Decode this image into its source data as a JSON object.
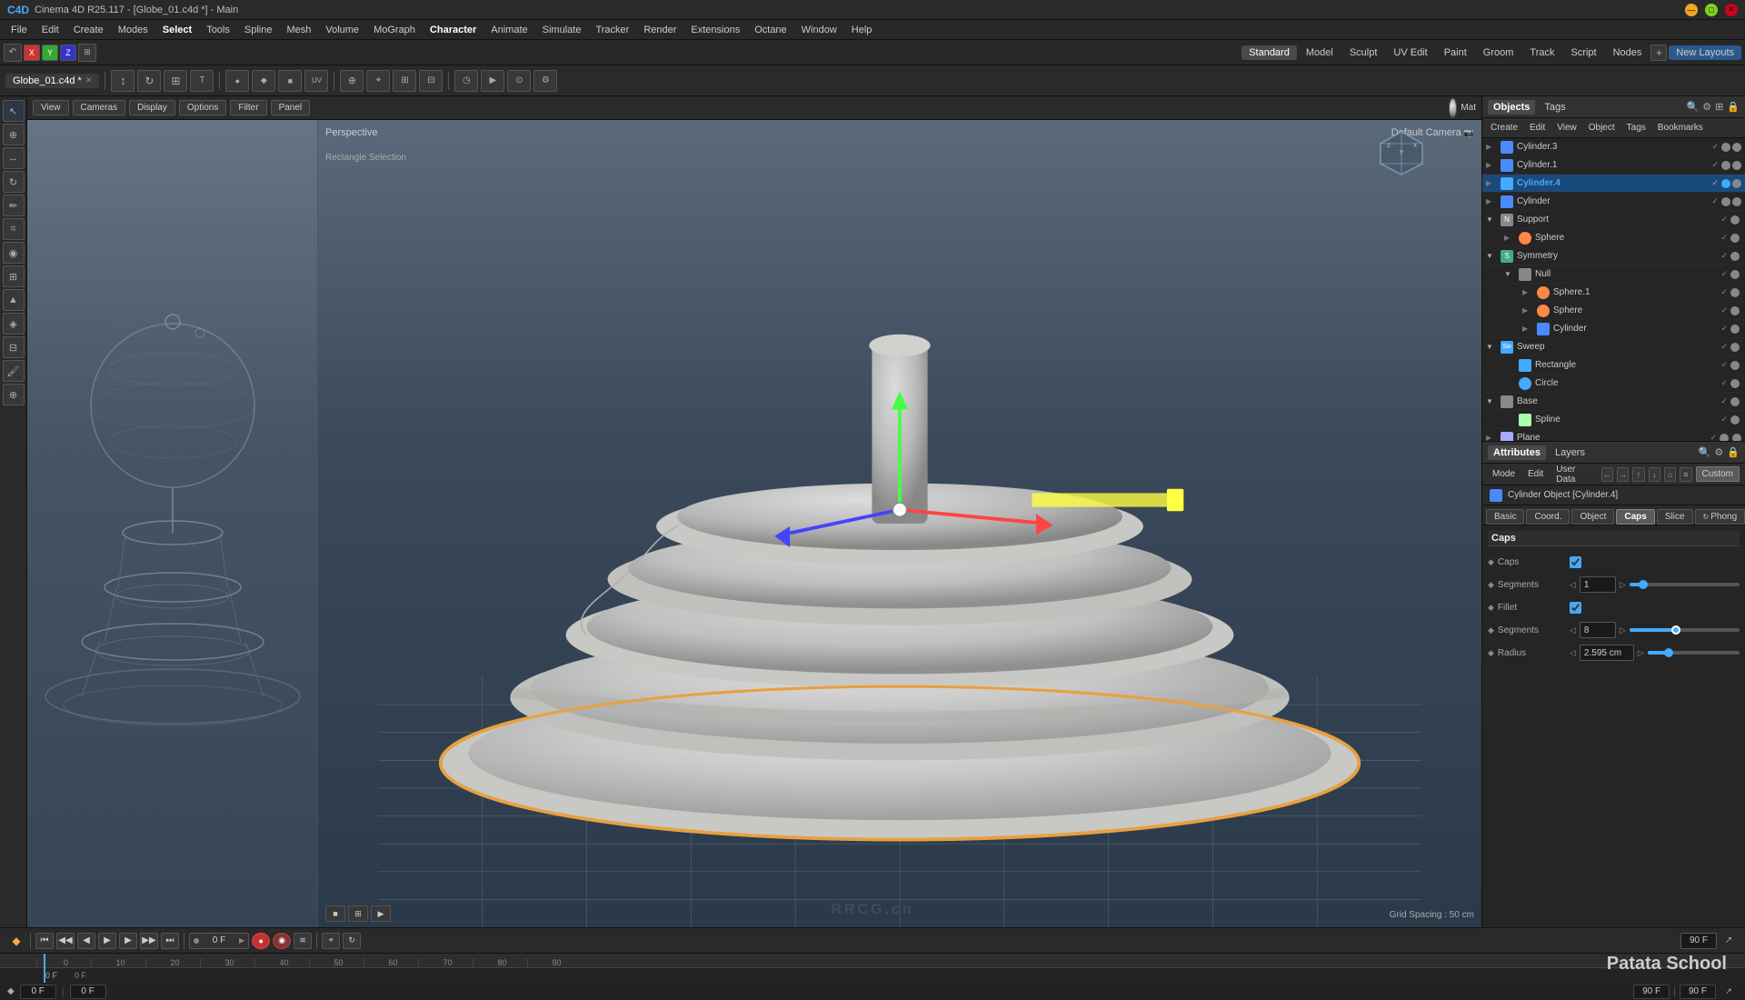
{
  "app": {
    "title": "Cinema 4D R25.117 - [Globe_01.c4d *] - Main",
    "version": "R25.117",
    "filename": "Globe_01.c4d",
    "watermark": "RRCG.cn"
  },
  "titlebar": {
    "title": "Cinema 4D R25.117 - [Globe_01.c4d *] - Main",
    "close": "✕",
    "minimize": "—",
    "maximize": "□"
  },
  "menubar": {
    "items": [
      "File",
      "Edit",
      "Create",
      "Modes",
      "Select",
      "Tools",
      "Spline",
      "Mesh",
      "Volume",
      "MoGraph",
      "Character",
      "Animate",
      "Simulate",
      "Tracker",
      "Render",
      "Extensions",
      "Octane",
      "Window",
      "Help"
    ]
  },
  "tabbar": {
    "tabs": [
      {
        "label": "Globe_01.c4d *",
        "active": true
      }
    ]
  },
  "toolbar": {
    "layout_label": "Standard",
    "mode_label": "Model",
    "sculpt_label": "Sculpt",
    "uv_label": "UV Edit",
    "paint_label": "Paint",
    "groom_label": "Groom",
    "track_label": "Track",
    "script_label": "Script",
    "nodes_label": "Nodes",
    "new_layouts_label": "New Layouts"
  },
  "viewport": {
    "perspective_label": "Perspective",
    "camera_label": "Default Camera",
    "grid_spacing": "Grid Spacing : 50 cm",
    "selection_label": "Rectangle Selection"
  },
  "objects_panel": {
    "title": "Objects",
    "tabs": [
      "Objects",
      "Tags"
    ],
    "secondary_tabs": [
      "Create",
      "Edit",
      "View",
      "Object",
      "Tags",
      "Bookmarks"
    ],
    "items": [
      {
        "name": "Cylinder.3",
        "indent": 0,
        "type": "cylinder",
        "color": "#888",
        "selected": false
      },
      {
        "name": "Cylinder.1",
        "indent": 0,
        "type": "cylinder",
        "color": "#888",
        "selected": false
      },
      {
        "name": "Cylinder.4",
        "indent": 0,
        "type": "cylinder",
        "color": "#4af",
        "selected": true,
        "highlight": true
      },
      {
        "name": "Cylinder",
        "indent": 0,
        "type": "cylinder",
        "color": "#888",
        "selected": false
      },
      {
        "name": "Support",
        "indent": 0,
        "type": "null",
        "color": "#888",
        "selected": false
      },
      {
        "name": "Sphere",
        "indent": 1,
        "type": "sphere",
        "color": "#888",
        "selected": false
      },
      {
        "name": "Symmetry",
        "indent": 0,
        "type": "symmetry",
        "color": "#888",
        "selected": false
      },
      {
        "name": "Null",
        "indent": 1,
        "type": "null",
        "color": "#888",
        "selected": false
      },
      {
        "name": "Sphere.1",
        "indent": 2,
        "type": "sphere",
        "color": "#888",
        "selected": false
      },
      {
        "name": "Sphere",
        "indent": 2,
        "type": "sphere",
        "color": "#888",
        "selected": false
      },
      {
        "name": "Cylinder",
        "indent": 2,
        "type": "cylinder",
        "color": "#888",
        "selected": false
      },
      {
        "name": "Sweep",
        "indent": 0,
        "type": "sweep",
        "color": "#888",
        "selected": false
      },
      {
        "name": "Rectangle",
        "indent": 1,
        "type": "rect",
        "color": "#888",
        "selected": false
      },
      {
        "name": "Circle",
        "indent": 1,
        "type": "circle",
        "color": "#888",
        "selected": false
      },
      {
        "name": "Base",
        "indent": 0,
        "type": "null",
        "color": "#888",
        "selected": false
      },
      {
        "name": "Spline",
        "indent": 1,
        "type": "spline",
        "color": "#888",
        "selected": false
      },
      {
        "name": "Plane",
        "indent": 0,
        "type": "plane",
        "color": "#888",
        "selected": false
      }
    ]
  },
  "attributes_panel": {
    "title": "Attributes",
    "tabs_left": [
      "Mode",
      "Edit",
      "User Data"
    ],
    "tabs_right": [
      "Custom"
    ],
    "object_label": "Cylinder Object [Cylinder.4]",
    "tabs": [
      "Basic",
      "Coord.",
      "Object",
      "Caps",
      "Slice",
      "Phong"
    ],
    "active_tab": "Caps",
    "section": "Caps",
    "fields": [
      {
        "label": "Caps",
        "type": "checkbox",
        "value": true
      },
      {
        "label": "Segments",
        "type": "number",
        "value": "1",
        "has_slider": true
      },
      {
        "label": "Fillet",
        "type": "checkbox",
        "value": true
      },
      {
        "label": "Segments",
        "type": "number",
        "value": "8",
        "has_slider": true,
        "slider_pos": 0.4
      },
      {
        "label": "Radius",
        "type": "number",
        "value": "2.595 cm",
        "has_slider": true,
        "slider_pos": 0.2
      }
    ]
  },
  "timeline": {
    "frame_current": "0 F",
    "frame_end": "90 F",
    "frame_end2": "90 F",
    "frame_start": "0 F",
    "frame_start2": "0 F",
    "markers": [
      "0",
      "10",
      "20",
      "30",
      "40",
      "50",
      "60",
      "70",
      "80",
      "90"
    ],
    "marker_positions": [
      0,
      100,
      200,
      300,
      400,
      450,
      500,
      600,
      700,
      800,
      900
    ]
  },
  "patata": "Patata School",
  "icons": {
    "play": "▶",
    "stop": "■",
    "rewind": "◀◀",
    "forward": "▶▶",
    "prev_frame": "◀",
    "next_frame": "▶",
    "first_frame": "⏮",
    "last_frame": "⏭",
    "record": "●",
    "arrow": "▶",
    "gear": "⚙",
    "search": "🔍",
    "lock": "🔒",
    "eye": "👁",
    "plus": "+",
    "minus": "−",
    "check": "✓",
    "x": "✕",
    "chevron_right": "▶",
    "chevron_down": "▼"
  }
}
